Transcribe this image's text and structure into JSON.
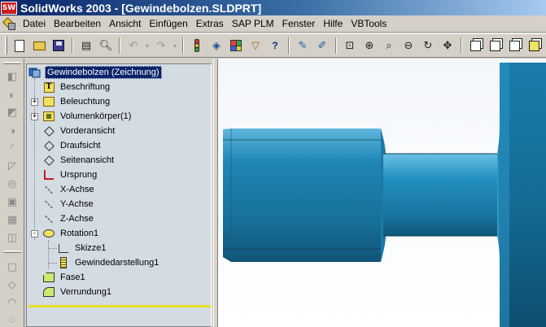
{
  "window": {
    "logo_text": "SW",
    "title": "SolidWorks 2003 - [Gewindebolzen.SLDPRT]"
  },
  "menu": {
    "items": [
      {
        "label": "Datei"
      },
      {
        "label": "Bearbeiten"
      },
      {
        "label": "Ansicht"
      },
      {
        "label": "Einfügen"
      },
      {
        "label": "Extras"
      },
      {
        "label": "SAP PLM"
      },
      {
        "label": "Fenster"
      },
      {
        "label": "Hilfe"
      },
      {
        "label": "VBTools"
      }
    ]
  },
  "toolbar": {
    "buttons": [
      "new-document",
      "open",
      "save",
      "print",
      "print-preview",
      "undo",
      "redo",
      "rebuild",
      "select-filter",
      "color-palette",
      "options",
      "help-pointer",
      "sketch-relations",
      "edit-sketch",
      "zoom-fit",
      "zoom-in",
      "zoom-window",
      "zoom-out",
      "rotate-view",
      "pan",
      "standard-view",
      "view-orientation",
      "isometric-view",
      "shaded-view"
    ],
    "help_pointer_glyph": "?"
  },
  "feature_tree": {
    "root": {
      "label": "Gewindebolzen  (Zeichnung)",
      "icon": "part-icon",
      "selected": true
    },
    "items": [
      {
        "label": "Beschriftung",
        "icon": "annotations-icon",
        "glyph": "T",
        "expander": ""
      },
      {
        "label": "Beleuchtung",
        "icon": "lighting-icon",
        "expander": "+"
      },
      {
        "label": "Volumenkörper(1)",
        "icon": "solid-bodies-folder-icon",
        "expander": "+"
      },
      {
        "label": "Vorderansicht",
        "icon": "plane-icon",
        "expander": ""
      },
      {
        "label": "Draufsicht",
        "icon": "plane-icon",
        "expander": ""
      },
      {
        "label": "Seitenansicht",
        "icon": "plane-icon",
        "expander": ""
      },
      {
        "label": "Ursprung",
        "icon": "origin-icon",
        "expander": ""
      },
      {
        "label": "X-Achse",
        "icon": "axis-icon",
        "expander": ""
      },
      {
        "label": "Y-Achse",
        "icon": "axis-icon",
        "expander": ""
      },
      {
        "label": "Z-Achse",
        "icon": "axis-icon",
        "expander": ""
      },
      {
        "label": "Rotation1",
        "icon": "revolve-icon",
        "expander": "-"
      },
      {
        "label": "Skizze1",
        "icon": "sketch-icon",
        "expander": "",
        "child": true
      },
      {
        "label": "Gewindedarstellung1",
        "icon": "cosmetic-thread-icon",
        "expander": "",
        "child": true
      },
      {
        "label": "Fase1",
        "icon": "chamfer-icon",
        "expander": ""
      },
      {
        "label": "Verrundung1",
        "icon": "fillet-icon",
        "expander": ""
      }
    ]
  },
  "colors": {
    "title_gradient_start": "#0a246a",
    "title_gradient_end": "#a6caf0",
    "part_color": "#1a7aa8",
    "tree_background": "#d3dbe3",
    "rollback_bar": "#e8e020"
  }
}
